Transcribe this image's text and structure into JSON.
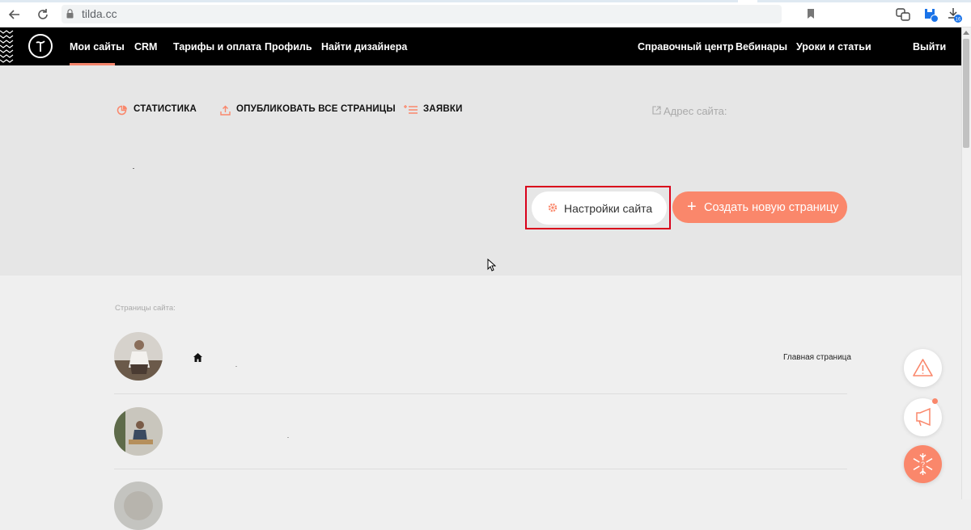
{
  "browser": {
    "url": "tilda.cc",
    "downloads_badge": "16"
  },
  "header": {
    "nav_left": [
      "Мои сайты",
      "CRM",
      "Тарифы и оплата",
      "Профиль",
      "Найти дизайнера"
    ],
    "nav_right": [
      "Справочный центр",
      "Вебинары",
      "Уроки и статьи"
    ],
    "logout": "Выйти"
  },
  "actions": {
    "statistics": "СТАТИСТИКА",
    "publish_all": "ОПУБЛИКОВАТЬ ВСЕ СТРАНИЦЫ",
    "leads": "ЗАЯВКИ",
    "site_address": "Адрес сайта:"
  },
  "buttons": {
    "settings": "Настройки сайта",
    "create_page": "Создать новую страницу"
  },
  "pages": {
    "title": "Страницы сайта:",
    "main_page_label": "Главная страница"
  },
  "colors": {
    "accent": "#fa876b",
    "header_bg": "#000000",
    "highlight": "#d9001b"
  }
}
